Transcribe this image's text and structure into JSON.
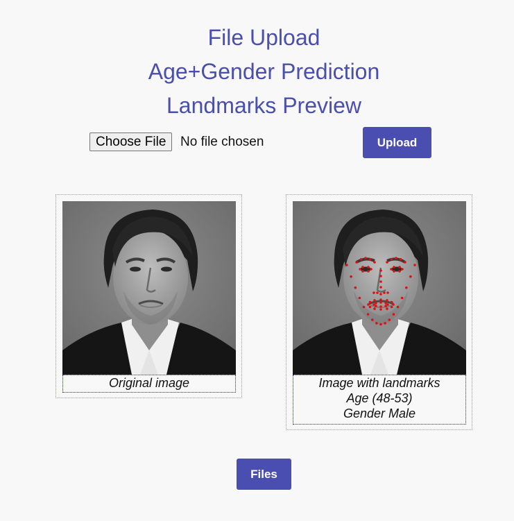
{
  "headings": {
    "line1": "File Upload",
    "line2": "Age+Gender Prediction",
    "line3": "Landmarks Preview"
  },
  "upload": {
    "choose_file_label": "Choose File",
    "file_status": "No file chosen",
    "upload_label": "Upload"
  },
  "cards": {
    "original": {
      "caption": "Original image"
    },
    "landmarks": {
      "caption_line1": "Image with landmarks",
      "caption_line2": "Age (48-53)",
      "caption_line3": "Gender Male"
    }
  },
  "footer": {
    "files_label": "Files"
  },
  "colors": {
    "heading": "#4a4eac",
    "button": "#4a4eb0",
    "landmark_dot": "#e01010"
  }
}
